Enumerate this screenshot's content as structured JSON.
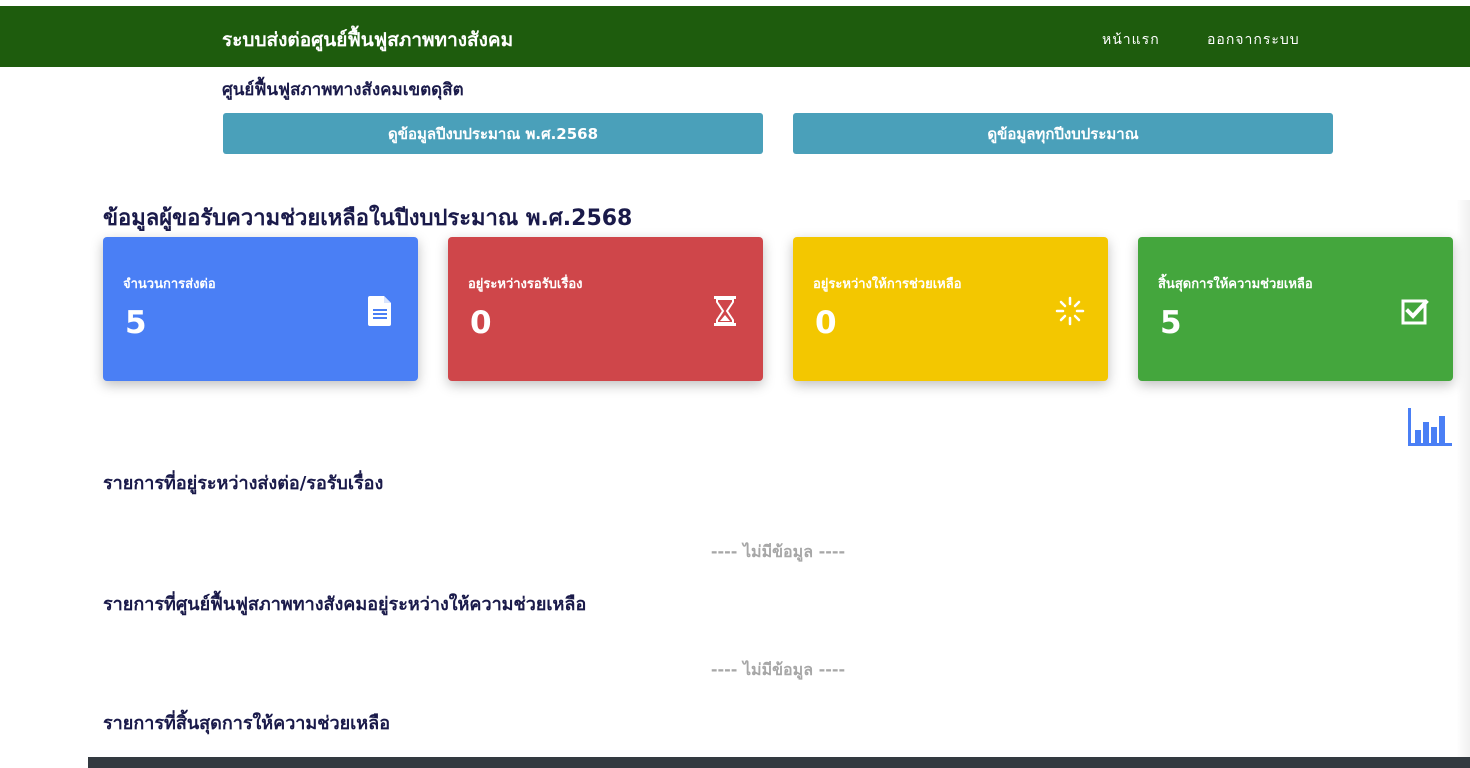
{
  "header": {
    "brand": "ระบบส่งต่อศูนย์ฟื้นฟูสภาพทางสังคม",
    "nav": {
      "home": "หน้าแรก",
      "logout": "ออกจากระบบ"
    }
  },
  "center_name": "ศูนย์ฟื้นฟูสภาพทางสังคมเขตดุสิต",
  "buttons": {
    "current_year": "ดูข้อมูลปีงบประมาณ พ.ศ.2568",
    "all_years": "ดูข้อมูลทุกปีงบประมาณ"
  },
  "section_title": "ข้อมูลผู้ขอรับความช่วยเหลือในปีงบประมาณ พ.ศ.2568",
  "cards": [
    {
      "label": "จำนวนการส่งต่อ",
      "value": "5",
      "icon": "document-icon",
      "color": "#4a7ff5"
    },
    {
      "label": "อยู่ระหว่างรอรับเรื่อง",
      "value": "0",
      "icon": "hourglass-icon",
      "color": "#cf464a"
    },
    {
      "label": "อยู่ระหว่างให้การช่วยเหลือ",
      "value": "0",
      "icon": "spinner-icon",
      "color": "#f3c700"
    },
    {
      "label": "สิ้นสุดการให้ความช่วยเหลือ",
      "value": "5",
      "icon": "checkbox-icon",
      "color": "#44a63d"
    }
  ],
  "chart_icon": "bar-chart-icon",
  "lists": [
    {
      "heading": "รายการที่อยู่ระหว่างส่งต่อ/รอรับเรื่อง",
      "empty_text": "---- ไม่มีข้อมูล ----"
    },
    {
      "heading": "รายการที่ศูนย์ฟื้นฟูสภาพทางสังคมอยู่ระหว่างให้ความช่วยเหลือ",
      "empty_text": "---- ไม่มีข้อมูล ----"
    },
    {
      "heading": "รายการที่สิ้นสุดการให้ความช่วยเหลือ"
    }
  ],
  "colors": {
    "header_bg": "#1e5c0d",
    "button_bg": "#4aa0ba",
    "heading_text": "#1a1a4a",
    "footer_bg": "#333a40"
  }
}
